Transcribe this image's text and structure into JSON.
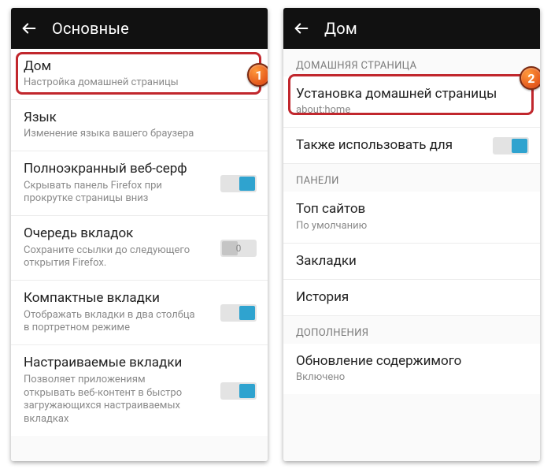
{
  "left": {
    "title": "Основные",
    "rows": [
      {
        "primary": "Дом",
        "secondary": "Настройка домашней страницы"
      },
      {
        "primary": "Язык",
        "secondary": "Изменение языка вашего браузера"
      },
      {
        "primary": "Полноэкранный веб-серф",
        "secondary": "Скрывать панель Firefox при прокрутке страницы вниз",
        "toggle": "on"
      },
      {
        "primary": "Очередь вкладок",
        "secondary": "Сохраните ссылки до следующего открытия Firefox.",
        "toggle": "off",
        "toggle_label": "0"
      },
      {
        "primary": "Компактные вкладки",
        "secondary": "Отображать вкладки в два столбца в портретном режиме",
        "toggle": "on"
      },
      {
        "primary": "Настраиваемые вкладки",
        "secondary": "Позволяет приложениям открывать веб-контент в быстро загружающихся настраиваемых вкладках",
        "toggle": "on"
      }
    ]
  },
  "right": {
    "title": "Дом",
    "section_homepage": "ДОМАШНЯЯ СТРАНИЦА",
    "homepage_row": {
      "primary": "Установка домашней страницы",
      "secondary": "about:home"
    },
    "also_use_row": {
      "primary": "Также использовать для",
      "toggle": "on"
    },
    "section_panels": "ПАНЕЛИ",
    "panels": [
      {
        "primary": "Топ сайтов",
        "secondary": "По умолчанию"
      },
      {
        "primary": "Закладки"
      },
      {
        "primary": "История"
      }
    ],
    "section_addons": "ДОПОЛНЕНИЯ",
    "addons_row": {
      "primary": "Обновление содержимого",
      "secondary": "Включено"
    }
  },
  "callouts": {
    "one": "1",
    "two": "2"
  }
}
